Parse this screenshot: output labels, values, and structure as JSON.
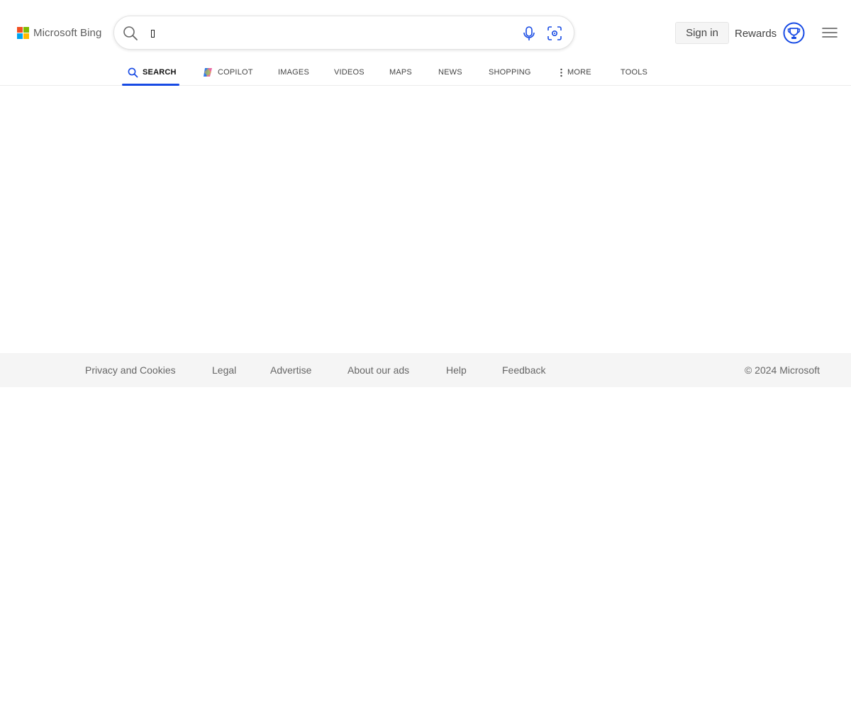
{
  "colors": {
    "accent": "#174ae4",
    "logo_red": "#f25022",
    "logo_green": "#7fba00",
    "logo_blue": "#00a4ef",
    "logo_yellow": "#ffb900",
    "footer_bg": "#f5f5f5"
  },
  "header": {
    "logo_text": "Microsoft Bing",
    "search": {
      "value": "",
      "search_icon": "search-icon",
      "mic_icon": "microphone-icon",
      "visual_search_icon": "visual-search-icon"
    },
    "sign_in_label": "Sign in",
    "rewards_label": "Rewards",
    "rewards_icon": "rewards-medal-icon",
    "menu_icon": "hamburger-menu-icon"
  },
  "tabs": [
    {
      "label": "SEARCH",
      "icon": "search-icon",
      "active": true
    },
    {
      "label": "COPILOT",
      "icon": "copilot-icon",
      "active": false
    },
    {
      "label": "IMAGES",
      "active": false
    },
    {
      "label": "VIDEOS",
      "active": false
    },
    {
      "label": "MAPS",
      "active": false
    },
    {
      "label": "NEWS",
      "active": false
    },
    {
      "label": "SHOPPING",
      "active": false
    },
    {
      "label": "MORE",
      "icon": "more-vertical-icon",
      "active": false
    },
    {
      "label": "TOOLS",
      "active": false
    }
  ],
  "footer": {
    "links": [
      "Privacy and Cookies",
      "Legal",
      "Advertise",
      "About our ads",
      "Help",
      "Feedback"
    ],
    "copyright": "© 2024 Microsoft"
  }
}
